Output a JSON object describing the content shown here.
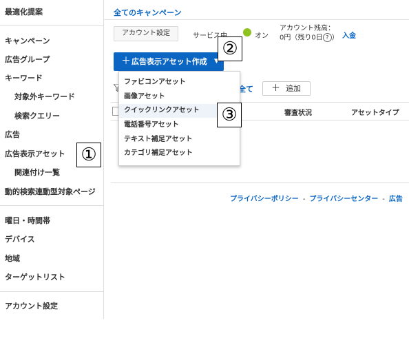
{
  "sidebar": {
    "items": [
      {
        "label": "最適化提案"
      },
      {
        "label": "キャンペーン"
      },
      {
        "label": "広告グループ"
      },
      {
        "label": "キーワード"
      },
      {
        "label": "対象外キーワード"
      },
      {
        "label": "検索クエリー"
      },
      {
        "label": "広告"
      },
      {
        "label": "広告表示アセット"
      },
      {
        "label": "関連付け一覧"
      },
      {
        "label": "動的検索連動型対象ページ"
      },
      {
        "label": "曜日・時間帯"
      },
      {
        "label": "デバイス"
      },
      {
        "label": "地域"
      },
      {
        "label": "ターゲットリスト"
      },
      {
        "label": "アカウント設定"
      }
    ]
  },
  "header": {
    "breadcrumb": "全てのキャンペーン",
    "account_settings_label": "アカウント設定",
    "service_label": "サービス中",
    "service_status": "オン",
    "balance_label": "アカウント残高：",
    "balance_value": "0円（残り0日",
    "balance_help": "?",
    "balance_close": "）",
    "deposit_label": "入金"
  },
  "toolbar": {
    "create_label": "広告表示アセット作成",
    "create_plus": "＋",
    "create_caret": "▼",
    "all_label": "全て",
    "add_plus": "＋",
    "add_label": "追加"
  },
  "dropdown": {
    "items": [
      {
        "label": "ファビコンアセット"
      },
      {
        "label": "画像アセット"
      },
      {
        "label": "クイックリンクアセット"
      },
      {
        "label": "電話番号アセット"
      },
      {
        "label": "テキスト補足アセット"
      },
      {
        "label": "カテゴリ補足アセット"
      }
    ]
  },
  "table": {
    "columns": [
      "審査状況",
      "アセットタイプ"
    ]
  },
  "footer": {
    "links": [
      "プライバシーポリシー",
      "プライバシーセンター",
      "広告"
    ],
    "separator": "-"
  },
  "callouts": [
    "①",
    "②",
    "③"
  ],
  "colors": {
    "accent": "#0b66c3",
    "status_on": "#8dc21f"
  }
}
